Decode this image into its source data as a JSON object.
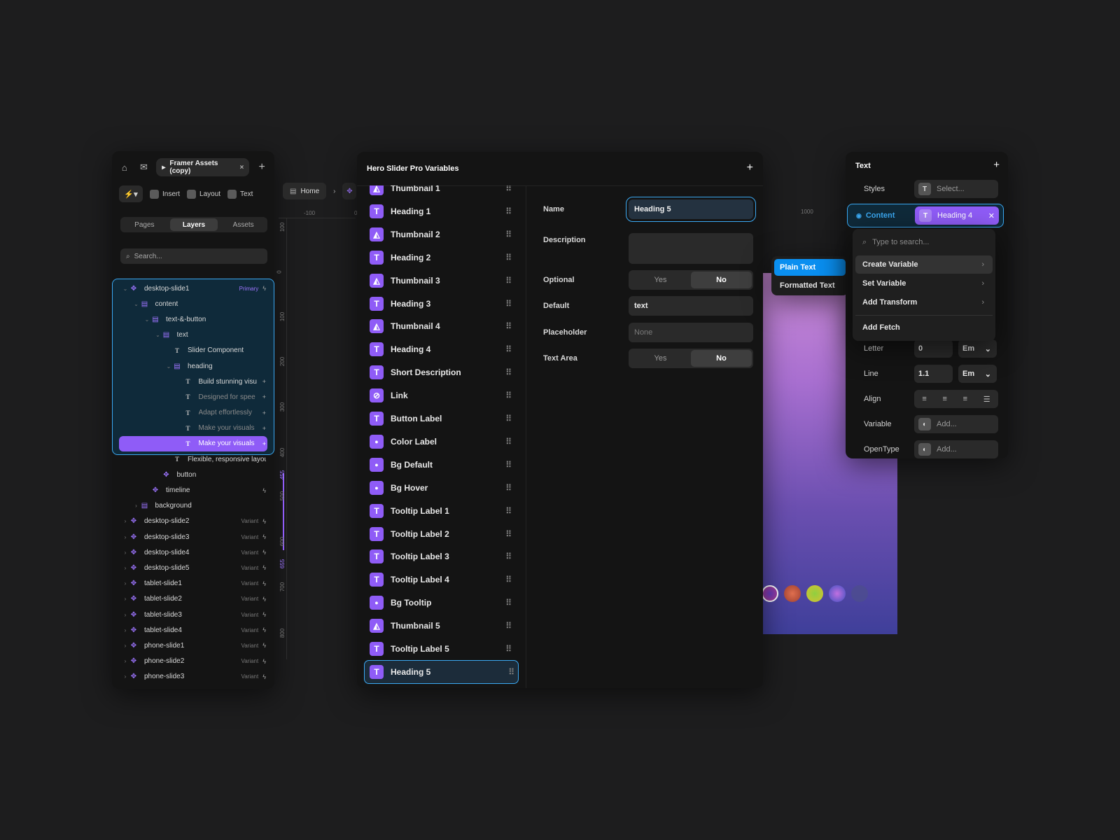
{
  "left_panel": {
    "project_tab": "Framer Assets (copy)",
    "toolbar": {
      "insert": "Insert",
      "layout": "Layout",
      "text": "Text"
    },
    "tabs": [
      "Pages",
      "Layers",
      "Assets"
    ],
    "search_placeholder": "Search...",
    "layers": [
      {
        "name": "desktop-slide1",
        "tag": "Primary"
      },
      {
        "name": "content"
      },
      {
        "name": "text-&-button"
      },
      {
        "name": "text"
      },
      {
        "name": "Slider Component"
      },
      {
        "name": "heading"
      },
      {
        "name": "Build stunning visu"
      },
      {
        "name": "Designed for spee"
      },
      {
        "name": "Adapt effortlessly"
      },
      {
        "name": "Make your visuals"
      },
      {
        "name": "Make your visuals"
      },
      {
        "name": "Flexible, responsive layout"
      },
      {
        "name": "button"
      },
      {
        "name": "timeline"
      },
      {
        "name": "background"
      },
      {
        "name": "desktop-slide2",
        "tag": "Variant"
      },
      {
        "name": "desktop-slide3",
        "tag": "Variant"
      },
      {
        "name": "desktop-slide4",
        "tag": "Variant"
      },
      {
        "name": "desktop-slide5",
        "tag": "Variant"
      },
      {
        "name": "tablet-slide1",
        "tag": "Variant"
      },
      {
        "name": "tablet-slide2",
        "tag": "Variant"
      },
      {
        "name": "tablet-slide3",
        "tag": "Variant"
      },
      {
        "name": "tablet-slide4",
        "tag": "Variant"
      },
      {
        "name": "phone-slide1",
        "tag": "Variant"
      },
      {
        "name": "phone-slide2",
        "tag": "Variant"
      },
      {
        "name": "phone-slide3",
        "tag": "Variant"
      }
    ]
  },
  "canvas": {
    "breadcrumb_home": "Home",
    "ruler_h": [
      "-100",
      "0"
    ],
    "ruler_v": [
      "100",
      "0",
      "100",
      "200",
      "300",
      "400",
      "455",
      "500",
      "600",
      "655",
      "700",
      "800"
    ],
    "ruler_right": "1000"
  },
  "middle_panel": {
    "title": "Hero Slider Pro Variables",
    "variables": [
      {
        "name": "Thumbnail 1",
        "type": "image"
      },
      {
        "name": "Heading 1",
        "type": "text"
      },
      {
        "name": "Thumbnail 2",
        "type": "image"
      },
      {
        "name": "Heading 2",
        "type": "text"
      },
      {
        "name": "Thumbnail 3",
        "type": "image"
      },
      {
        "name": "Heading 3",
        "type": "text"
      },
      {
        "name": "Thumbnail 4",
        "type": "image"
      },
      {
        "name": "Heading 4",
        "type": "text"
      },
      {
        "name": "Short Description",
        "type": "text"
      },
      {
        "name": "Link",
        "type": "link"
      },
      {
        "name": "Button Label",
        "type": "text"
      },
      {
        "name": "Color Label",
        "type": "color"
      },
      {
        "name": "Bg Default",
        "type": "color"
      },
      {
        "name": "Bg Hover",
        "type": "color"
      },
      {
        "name": "Tooltip Label 1",
        "type": "text"
      },
      {
        "name": "Tooltip Label 2",
        "type": "text"
      },
      {
        "name": "Tooltip Label 3",
        "type": "text"
      },
      {
        "name": "Tooltip Label 4",
        "type": "text"
      },
      {
        "name": "Bg Tooltip",
        "type": "color"
      },
      {
        "name": "Thumbnail 5",
        "type": "image"
      },
      {
        "name": "Tooltip Label 5",
        "type": "text"
      },
      {
        "name": "Heading 5",
        "type": "text"
      }
    ],
    "form": {
      "name_label": "Name",
      "name_value": "Heading 5",
      "description_label": "Description",
      "optional_label": "Optional",
      "default_label": "Default",
      "default_value": "text",
      "placeholder_label": "Placeholder",
      "placeholder_value": "None",
      "textarea_label": "Text Area",
      "yes": "Yes",
      "no": "No"
    }
  },
  "type_popup": {
    "items": [
      "Plain Text",
      "Formatted Text"
    ],
    "selected": "Plain Text"
  },
  "right_panel": {
    "title": "Text",
    "styles_label": "Styles",
    "styles_value": "Select...",
    "content_label": "Content",
    "content_chip": "Heading 4",
    "letter_label": "Letter",
    "letter_value": "0",
    "letter_unit": "Em",
    "line_label": "Line",
    "line_value": "1.1",
    "line_unit": "Em",
    "align_label": "Align",
    "variable_label": "Variable",
    "variable_value": "Add...",
    "opentype_label": "OpenType",
    "opentype_value": "Add..."
  },
  "menu": {
    "search_placeholder": "Type to search...",
    "items": [
      "Create Variable",
      "Set Variable",
      "Add Transform",
      "Add Fetch"
    ]
  },
  "colors": {
    "accent": "#8f5cf7",
    "focus": "#3ba9f3",
    "selected_blue": "#0a8ff0"
  }
}
